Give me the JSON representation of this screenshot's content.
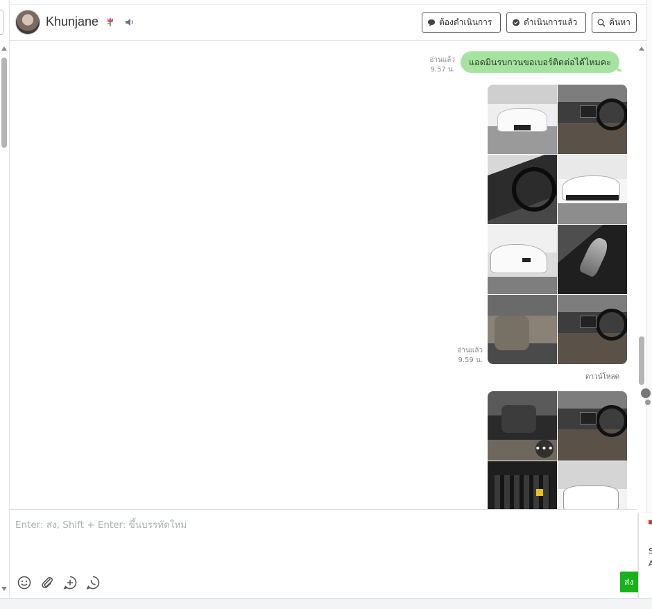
{
  "header": {
    "contact_name": "Khunjane",
    "buttons": {
      "pending": "ต้องดำเนินการ",
      "done": "ดำเนินการแล้ว",
      "search": "ค้นหา"
    }
  },
  "messages": [
    {
      "type": "text",
      "text": "แอดมินรบกวนขอเบอร์ติดต่อได้ไหมคะ",
      "status": "อ่านแล้ว",
      "time": "9.57 น."
    },
    {
      "type": "image_album",
      "image_count": 8,
      "status": "อ่านแล้ว",
      "time": "9.59 น.",
      "download_label": "ดาวน์โหลด"
    },
    {
      "type": "image_album",
      "image_count_visible": 4,
      "more_label": "•••"
    }
  ],
  "composer": {
    "placeholder": "Enter: ส่ง, Shift + Enter: ขึ้นบรรทัดใหม่",
    "value": "",
    "send_label": "ส่ง"
  },
  "edge_panel": {
    "line1": "S",
    "line2": "A"
  },
  "icons": {
    "emoji": "smiley-icon",
    "attach": "paperclip-icon",
    "add": "plus-circle-icon",
    "call": "phone-bubble-icon"
  },
  "colors": {
    "bubble": "#a6e3a1",
    "send": "#17b21a"
  }
}
